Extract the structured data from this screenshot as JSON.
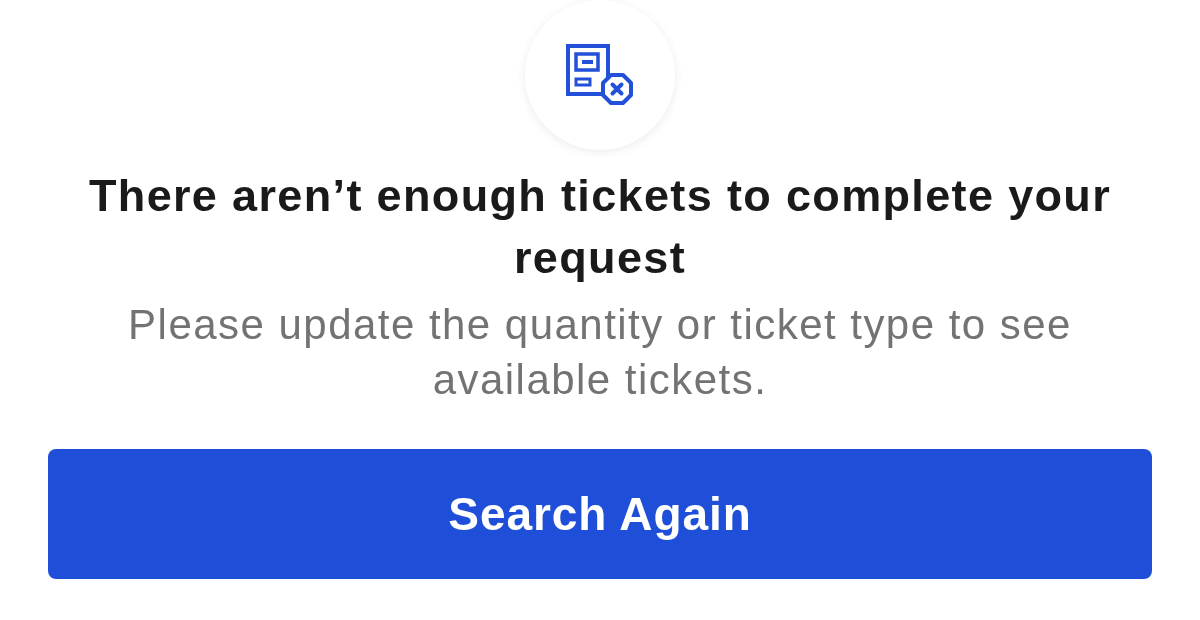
{
  "message": {
    "title": "There aren’t enough tickets to complete your request",
    "body": "Please update the quantity or ticket type to see available tickets."
  },
  "button": {
    "label": "Search Again"
  }
}
